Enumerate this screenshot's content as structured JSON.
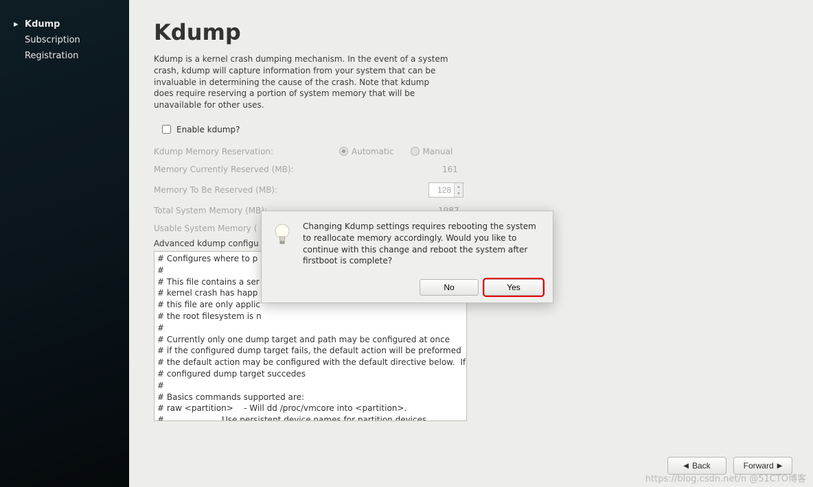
{
  "sidebar": {
    "items": [
      {
        "label": "Kdump"
      },
      {
        "label": "Subscription"
      },
      {
        "label": "Registration"
      }
    ]
  },
  "page": {
    "title": "Kdump",
    "description": "Kdump is a kernel crash dumping mechanism. In the event of a system crash, kdump will capture information from your system that can be invaluable in determining the cause of the crash. Note that kdump does require reserving a portion of system memory that will be unavailable for other uses."
  },
  "enable": {
    "label": "Enable kdump?",
    "checked": false
  },
  "settings": {
    "reservation_label": "Kdump Memory Reservation:",
    "reservation_mode": "automatic",
    "automatic_label": "Automatic",
    "manual_label": "Manual",
    "current_label": "Memory Currently Reserved (MB):",
    "current_value": "161",
    "toreserve_label": "Memory To Be Reserved (MB):",
    "toreserve_value": "128",
    "total_label": "Total System Memory (MB):",
    "total_value": "1987",
    "usable_label": "Usable System Memory ("
  },
  "advanced": {
    "label": "Advanced kdump configu",
    "content": "# Configures where to p\n#\n# This file contains a ser\n# kernel crash has happ\n# this file are only applic\n# the root filesystem is n\n#\n# Currently only one dump target and path may be configured at once\n# if the configured dump target fails, the default action will be preformed\n# the default action may be configured with the default directive below.  If th\n# configured dump target succedes\n#\n# Basics commands supported are:\n# raw <partition>    - Will dd /proc/vmcore into <partition>.\n#                      Use persistent device names for partition devices,\n#                      such as /dev/vg/<devname>.\n#\n# nfs <nfs mount>        - Will mount fs and copy /proc/vmcore to\n#                  <mnt>/var/crash/%HOST-%DATE/, supports DNS."
  },
  "dialog": {
    "message": "Changing Kdump settings requires rebooting the system to reallocate memory accordingly. Would you like to continue with this change and reboot the system after firstboot is complete?",
    "no_label": "No",
    "yes_label": "Yes"
  },
  "footer": {
    "back_label": "Back",
    "forward_label": "Forward"
  },
  "watermark": "https://blog.csdn.net/n @51CTO博客"
}
